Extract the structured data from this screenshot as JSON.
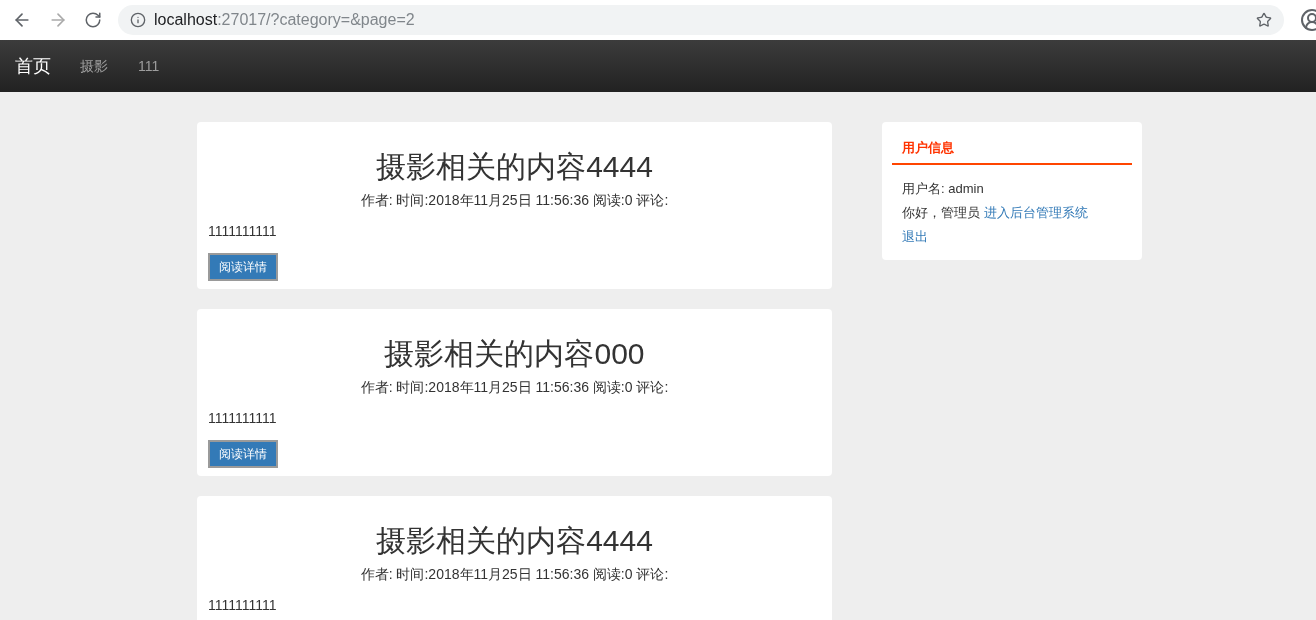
{
  "browser": {
    "url_host": "localhost",
    "url_rest": ":27017/?category=&page=2"
  },
  "nav": {
    "brand": "首页",
    "items": [
      {
        "label": "摄影"
      },
      {
        "label": "111"
      }
    ]
  },
  "posts": [
    {
      "title": "摄影相关的内容4444",
      "meta": "作者: 时间:2018年11月25日 11:56:36 阅读:0 评论:",
      "body": "1111111111",
      "button": "阅读详情"
    },
    {
      "title": "摄影相关的内容000",
      "meta": "作者: 时间:2018年11月25日 11:56:36 阅读:0 评论:",
      "body": "1111111111",
      "button": "阅读详情"
    },
    {
      "title": "摄影相关的内容4444",
      "meta": "作者: 时间:2018年11月25日 11:56:36 阅读:0 评论:",
      "body": "1111111111"
    }
  ],
  "user_panel": {
    "heading": "用户信息",
    "username": "用户名: admin",
    "greeting": "你好，管理员",
    "admin_link": "进入后台管理系统",
    "logout": "退出"
  }
}
